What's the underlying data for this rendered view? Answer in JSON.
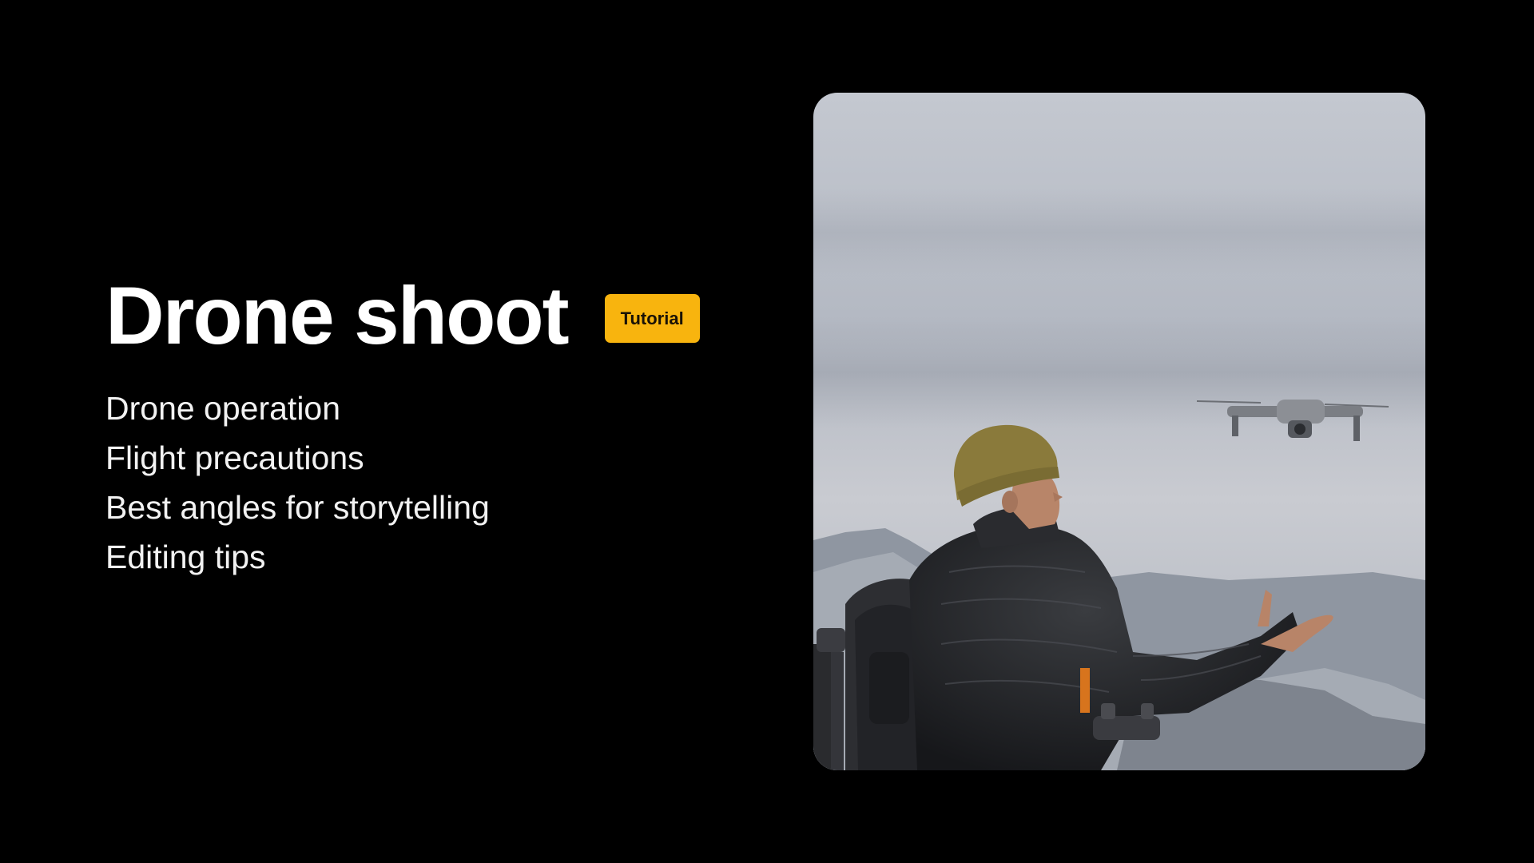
{
  "slide": {
    "title": "Drone shoot",
    "badge": "Tutorial",
    "topics": [
      "Drone operation",
      "Flight precautions",
      "Best angles for storytelling",
      "Editing tips"
    ]
  },
  "photo": {
    "subject": "person-launching-drone-illustration"
  },
  "colors": {
    "background": "#000000",
    "title": "#ffffff",
    "badge_bg": "#f8b40e",
    "badge_text": "#1a1206",
    "list_text": "#f2f2f2"
  }
}
